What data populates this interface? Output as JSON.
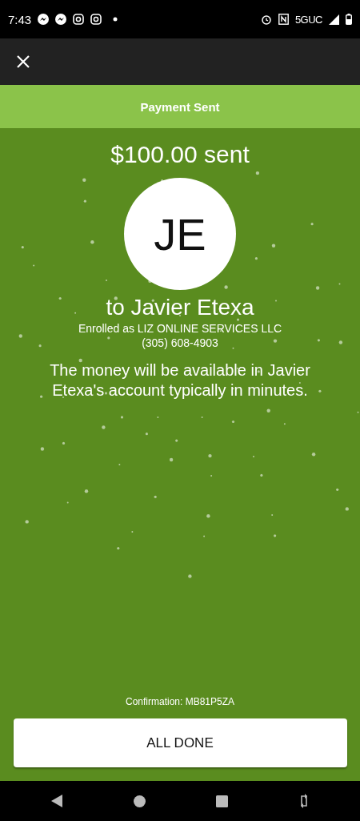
{
  "status_bar": {
    "time": "7:43",
    "network": "5GUC"
  },
  "header": {
    "title": "Payment Sent"
  },
  "payment": {
    "amount": "$100.00 sent",
    "initials": "JE",
    "recipient": "to Javier Etexa",
    "enrolled": "Enrolled as LIZ ONLINE SERVICES LLC",
    "phone": "(305) 608-4903",
    "message": "The money will be available in Javier Etexa's account typically in minutes.",
    "confirmation": "Confirmation: MB81P5ZA"
  },
  "buttons": [
    "ALL DONE"
  ]
}
